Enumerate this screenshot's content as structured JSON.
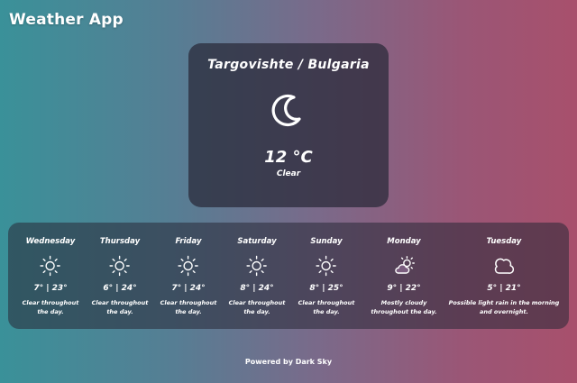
{
  "app": {
    "title": "Weather App"
  },
  "current": {
    "location": "Targovishte / Bulgaria",
    "icon": "moon-icon",
    "temperature": "12 °C",
    "summary": "Clear"
  },
  "forecast": [
    {
      "day": "Wednesday",
      "icon": "sun-icon",
      "temp": "7° | 23°",
      "summary_line1": "Clear throughout",
      "summary_line2": "the day."
    },
    {
      "day": "Thursday",
      "icon": "sun-icon",
      "temp": "6° | 24°",
      "summary_line1": "Clear throughout",
      "summary_line2": "the day."
    },
    {
      "day": "Friday",
      "icon": "sun-icon",
      "temp": "7° | 24°",
      "summary_line1": "Clear throughout",
      "summary_line2": "the day."
    },
    {
      "day": "Saturday",
      "icon": "sun-icon",
      "temp": "8° | 24°",
      "summary_line1": "Clear throughout",
      "summary_line2": "the day."
    },
    {
      "day": "Sunday",
      "icon": "sun-icon",
      "temp": "8° | 25°",
      "summary_line1": "Clear throughout",
      "summary_line2": "the day."
    },
    {
      "day": "Monday",
      "icon": "partly-cloudy-icon",
      "temp": "9° | 22°",
      "summary_line1": "Mostly cloudy",
      "summary_line2": "throughout the day."
    },
    {
      "day": "Tuesday",
      "icon": "cloud-icon",
      "temp": "5° | 21°",
      "summary_line1": "Possible light rain in the morning",
      "summary_line2": "and overnight."
    }
  ],
  "footer": {
    "text": "Powered by Dark Sky"
  }
}
